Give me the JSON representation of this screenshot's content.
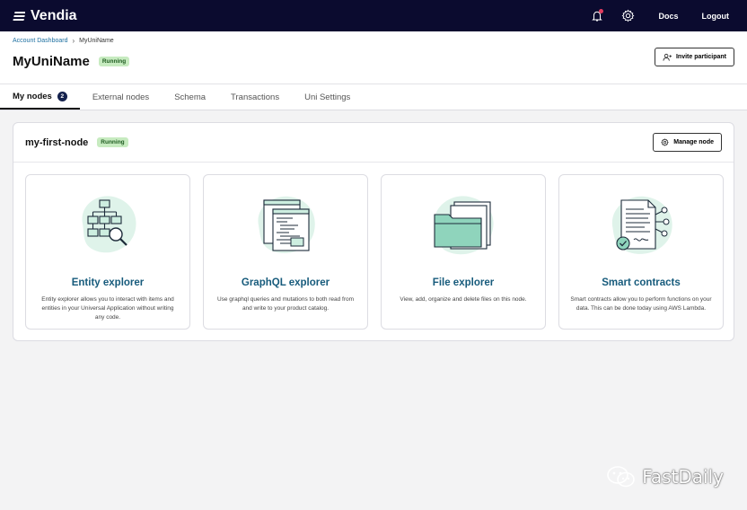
{
  "brand": {
    "name": "Vendia"
  },
  "topbar": {
    "bell_icon": "bell-icon",
    "settings_icon": "gear-icon",
    "docs_label": "Docs",
    "logout_label": "Logout"
  },
  "breadcrumb": {
    "root": "Account Dashboard",
    "current": "MyUniName"
  },
  "header": {
    "title": "MyUniName",
    "status": "Running",
    "invite_label": "Invite participant"
  },
  "tabs": [
    {
      "label": "My nodes",
      "count": "2",
      "active": true
    },
    {
      "label": "External nodes"
    },
    {
      "label": "Schema"
    },
    {
      "label": "Transactions"
    },
    {
      "label": "Uni Settings"
    }
  ],
  "node": {
    "name": "my-first-node",
    "status": "Running",
    "manage_label": "Manage node"
  },
  "cards": [
    {
      "title": "Entity explorer",
      "description": "Entity explorer allows you to interact with items and entities in your Universal Application without writing any code.",
      "icon": "entity-explorer-illustration"
    },
    {
      "title": "GraphQL explorer",
      "description": "Use graphql queries and mutations to both read from and write to your product catalog.",
      "icon": "graphql-explorer-illustration"
    },
    {
      "title": "File explorer",
      "description": "View, add, organize and delete files on this node.",
      "icon": "file-explorer-illustration"
    },
    {
      "title": "Smart contracts",
      "description": "Smart contracts allow you to perform functions on your data. This can be done today using AWS Lambda.",
      "icon": "smart-contracts-illustration"
    }
  ],
  "watermark": {
    "text": "FastDaily"
  },
  "colors": {
    "topbar": "#0b0b2f",
    "accent_teal": "#175b7c",
    "running_badge": "#c7ebc0",
    "illustration_bg": "#dff3ea"
  }
}
